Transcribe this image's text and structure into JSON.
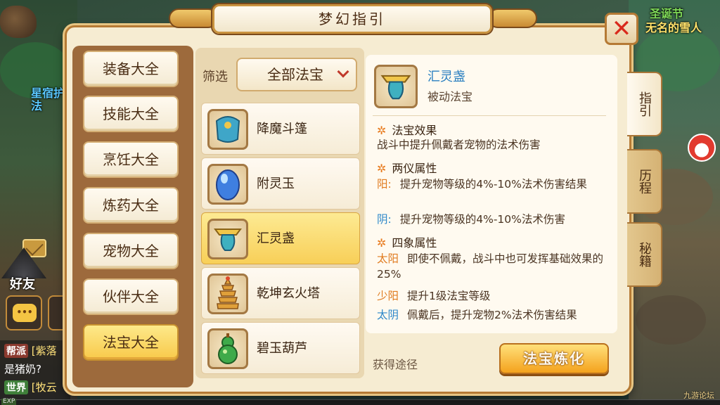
{
  "background": {
    "top_right_event": "圣诞节",
    "top_right_name": "无名的雪人",
    "left_npc_name": "星宿护法",
    "friends_label": "好友",
    "chat": [
      {
        "tag": "帮派",
        "text": "[紫落"
      },
      {
        "tag": "",
        "text": "是猪奶?"
      },
      {
        "tag": "世界",
        "text": "[牧云"
      }
    ],
    "exp_label": "EXP",
    "watermark": "九游论坛"
  },
  "dialog": {
    "title": "梦幻指引",
    "close_symbol": "✕"
  },
  "categories": [
    {
      "label": "装备大全",
      "active": false
    },
    {
      "label": "技能大全",
      "active": false
    },
    {
      "label": "烹饪大全",
      "active": false
    },
    {
      "label": "炼药大全",
      "active": false
    },
    {
      "label": "宠物大全",
      "active": false
    },
    {
      "label": "伙伴大全",
      "active": false
    },
    {
      "label": "法宝大全",
      "active": true
    }
  ],
  "filter": {
    "label": "筛选",
    "selected": "全部法宝"
  },
  "items": [
    {
      "name": "降魔斗篷",
      "icon": "cloak-icon",
      "active": false
    },
    {
      "name": "附灵玉",
      "icon": "blue-jade-icon",
      "active": false
    },
    {
      "name": "汇灵盏",
      "icon": "lamp-icon",
      "active": true
    },
    {
      "name": "乾坤玄火塔",
      "icon": "pagoda-icon",
      "active": false
    },
    {
      "name": "碧玉葫芦",
      "icon": "gourd-icon",
      "active": false
    }
  ],
  "detail": {
    "name": "汇灵盏",
    "type": "被动法宝",
    "sections": {
      "effect_title": "法宝效果",
      "effect_text": "战斗中提升佩戴者宠物的法术伤害",
      "two_title": "两仪属性",
      "yang_label": "阳:",
      "yang_text": "提升宠物等级的4%-10%法术伤害结果",
      "yin_label": "阴:",
      "yin_text": "提升宠物等级的4%-10%法术伤害",
      "four_title": "四象属性",
      "taiyang_label": "太阳",
      "taiyang_text": "即使不佩戴，战斗中也可发挥基础效果的25%",
      "shaoyang_label": "少阳",
      "shaoyang_text": "提升1级法宝等级",
      "taiyin_label": "太阴",
      "taiyin_text": "佩戴后，提升宠物2%法术伤害结果"
    },
    "obtain_label": "获得途径",
    "refine_button": "法宝炼化"
  },
  "side_tabs": [
    {
      "label": "指引",
      "active": true
    },
    {
      "label": "历程",
      "active": false
    },
    {
      "label": "秘籍",
      "active": false
    }
  ],
  "colors": {
    "accent_gold": "#f8c94a",
    "link_blue": "#2a7fc0",
    "label_orange": "#e07b1f",
    "close_red": "#d92a1c"
  }
}
